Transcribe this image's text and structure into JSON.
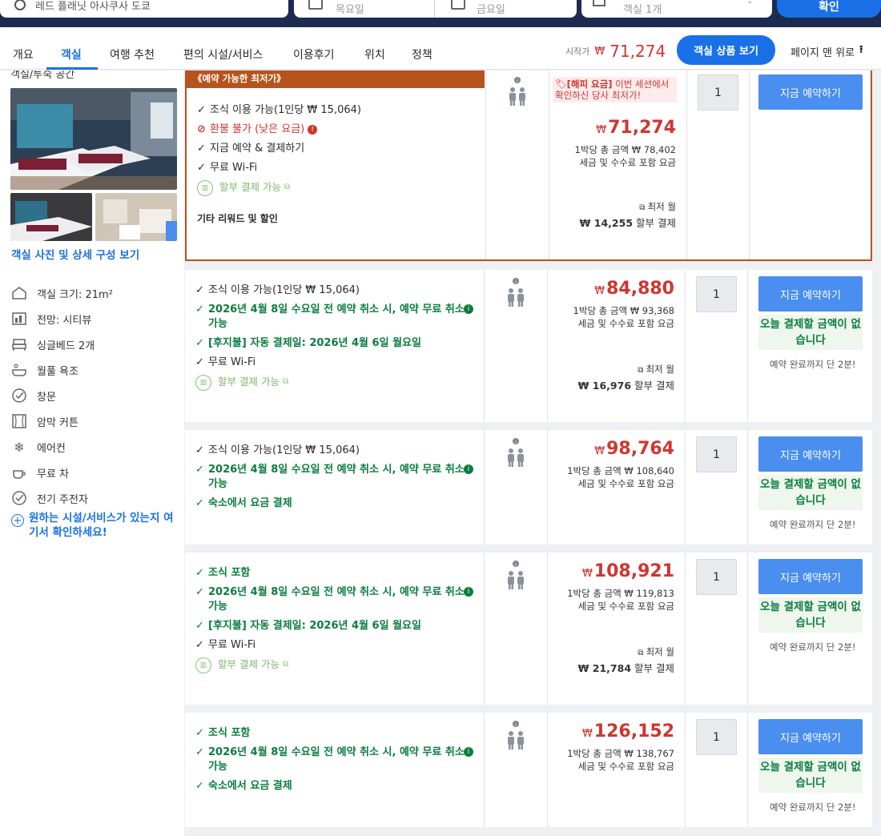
{
  "search": {
    "destination": "레드 플래닛 아사쿠사 도쿄",
    "checkin": "목요일",
    "checkout": "금요일",
    "guests": "객실 1개",
    "button": "확인"
  },
  "nav": {
    "tabs": [
      "개요",
      "객실",
      "여행 추천",
      "편의 시설/서비스",
      "이용후기",
      "위치",
      "정책"
    ],
    "active": "객실",
    "start_label": "시작가",
    "start_currency": "₩",
    "start_price": "71,274",
    "view_rooms": "객실 상품 보기",
    "top_label": "페이지 맨 위로"
  },
  "room": {
    "section_title": "객실/투숙 공간",
    "photos_link": "객실 사진 및 상세 구성 보기",
    "features": [
      {
        "icon": "room-size-icon",
        "label": "객실 크기: 21m²"
      },
      {
        "icon": "city-view-icon",
        "label": "전망: 시티뷰"
      },
      {
        "icon": "bed-icon",
        "label": "싱글베드 2개"
      },
      {
        "icon": "bathtub-icon",
        "label": "월풀 욕조"
      },
      {
        "icon": "check-circle-icon",
        "label": "창문"
      },
      {
        "icon": "curtain-icon",
        "label": "암막 커튼"
      },
      {
        "icon": "snowflake-icon",
        "label": "에어컨"
      },
      {
        "icon": "tea-icon",
        "label": "무료 차"
      },
      {
        "icon": "check-circle-icon",
        "label": "전기 주전자"
      }
    ],
    "more_link": "원하는 시설/서비스가 있는지 여기서 확인하세요!"
  },
  "offers": [
    {
      "banner": "《예약 가능한 최저가》",
      "lines": [
        {
          "text": "조식 이용 가능(1인당 ₩ 15,064)",
          "style": "k",
          "icon": "check"
        },
        {
          "text": "환불 불가 (낮은 요금)",
          "style": "r",
          "icon": "ban"
        },
        {
          "text": "지금 예약 & 결제하기",
          "style": "k",
          "icon": "check"
        },
        {
          "text": "무료 Wi-Fi",
          "style": "k",
          "icon": "check"
        },
        {
          "text": "할부 결제 가능",
          "style": "inst",
          "icon": "inst"
        }
      ],
      "extra": "기타 리워드 및 할인",
      "happy_tag": "[해피 요금]",
      "happy_text": " 이번 세션에서 확인하신 당사 최저가!",
      "currency": "₩",
      "price": "71,274",
      "per_night": "1박당 총 금액 ₩ 78,402",
      "tax": "세금 및 수수료 포함 요금",
      "monthly_label": "최저 월",
      "monthly": "₩ 14,255",
      "monthly_suffix": "할부 결제",
      "qty": "1",
      "book": "지금 예약하기"
    },
    {
      "lines": [
        {
          "text": "조식 이용 가능(1인당 ₩ 15,064)",
          "style": "k",
          "icon": "check"
        },
        {
          "text": "2026년 4월 8일 수요일 전 예약 취소 시, 예약 무료 취소 가능",
          "style": "g",
          "icon": "check",
          "info": true
        },
        {
          "text": "[후지불] 자동 결제일: 2026년 4월 6일 월요일",
          "style": "g",
          "icon": "check"
        },
        {
          "text": "무료 Wi-Fi",
          "style": "k",
          "icon": "check"
        },
        {
          "text": "할부 결제 가능",
          "style": "inst",
          "icon": "inst"
        }
      ],
      "currency": "₩",
      "price": "84,880",
      "per_night": "1박당 총 금액 ₩ 93,368",
      "tax": "세금 및 수수료 포함 요금",
      "monthly_label": "최저 월",
      "monthly": "₩ 16,976",
      "monthly_suffix": "할부 결제",
      "qty": "1",
      "book": "지금 예약하기",
      "pay_today": "오늘 결제할 금액이 없습니다",
      "note": "예약 완료까지 단 2분!"
    },
    {
      "lines": [
        {
          "text": "조식 이용 가능(1인당 ₩ 15,064)",
          "style": "k",
          "icon": "check"
        },
        {
          "text": "2026년 4월 8일 수요일 전 예약 취소 시, 예약 무료 취소 가능",
          "style": "g",
          "icon": "check",
          "info": true
        },
        {
          "text": "숙소에서 요금 결제",
          "style": "g",
          "icon": "check"
        }
      ],
      "currency": "₩",
      "price": "98,764",
      "per_night": "1박당 총 금액 ₩ 108,640",
      "tax": "세금 및 수수료 포함 요금",
      "qty": "1",
      "book": "지금 예약하기",
      "pay_today": "오늘 결제할 금액이 없습니다",
      "note": "예약 완료까지 단 2분!"
    },
    {
      "lines": [
        {
          "text": "조식 포함",
          "style": "g",
          "icon": "check"
        },
        {
          "text": "2026년 4월 8일 수요일 전 예약 취소 시, 예약 무료 취소 가능",
          "style": "g",
          "icon": "check",
          "info": true
        },
        {
          "text": "[후지불] 자동 결제일: 2026년 4월 6일 월요일",
          "style": "g",
          "icon": "check"
        },
        {
          "text": "무료 Wi-Fi",
          "style": "k",
          "icon": "check"
        },
        {
          "text": "할부 결제 가능",
          "style": "inst",
          "icon": "inst"
        }
      ],
      "currency": "₩",
      "price": "108,921",
      "per_night": "1박당 총 금액 ₩ 119,813",
      "tax": "세금 및 수수료 포함 요금",
      "monthly_label": "최저 월",
      "monthly": "₩ 21,784",
      "monthly_suffix": "할부 결제",
      "qty": "1",
      "book": "지금 예약하기",
      "pay_today": "오늘 결제할 금액이 없습니다",
      "note": "예약 완료까지 단 2분!"
    },
    {
      "lines": [
        {
          "text": "조식 포함",
          "style": "g",
          "icon": "check"
        },
        {
          "text": "2026년 4월 8일 수요일 전 예약 취소 시, 예약 무료 취소 가능",
          "style": "g",
          "icon": "check",
          "info": true
        },
        {
          "text": "숙소에서 요금 결제",
          "style": "g",
          "icon": "check"
        }
      ],
      "currency": "₩",
      "price": "126,152",
      "per_night": "1박당 총 금액 ₩ 138,767",
      "tax": "세금 및 수수료 포함 요금",
      "qty": "1",
      "book": "지금 예약하기",
      "pay_today": "오늘 결제할 금액이 없습니다",
      "note": "예약 완료까지 단 2분!"
    }
  ]
}
